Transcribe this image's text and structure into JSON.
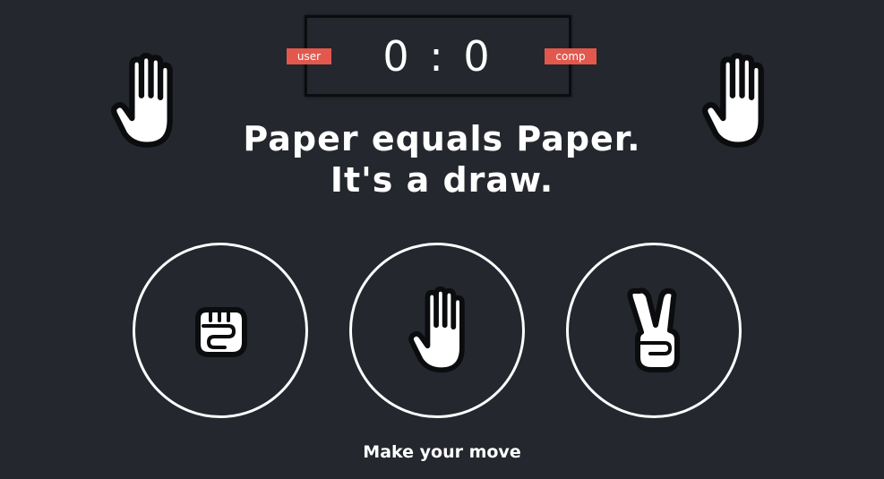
{
  "scoreboard": {
    "score": "0 : 0",
    "user_label": "user",
    "comp_label": "comp",
    "badge_color": "#e2584d"
  },
  "result": {
    "line1": "Paper equals Paper.",
    "line2": "It's a draw."
  },
  "user_choice_icon": "paper-hand-icon",
  "comp_choice_icon": "paper-hand-icon",
  "choices": [
    {
      "name": "rock",
      "icon": "rock-fist-icon"
    },
    {
      "name": "paper",
      "icon": "paper-hand-icon"
    },
    {
      "name": "scissors",
      "icon": "scissors-hand-icon"
    }
  ],
  "prompt": "Make your move",
  "colors": {
    "background": "#24272e",
    "foreground": "#ffffff",
    "accent": "#e2584d"
  }
}
